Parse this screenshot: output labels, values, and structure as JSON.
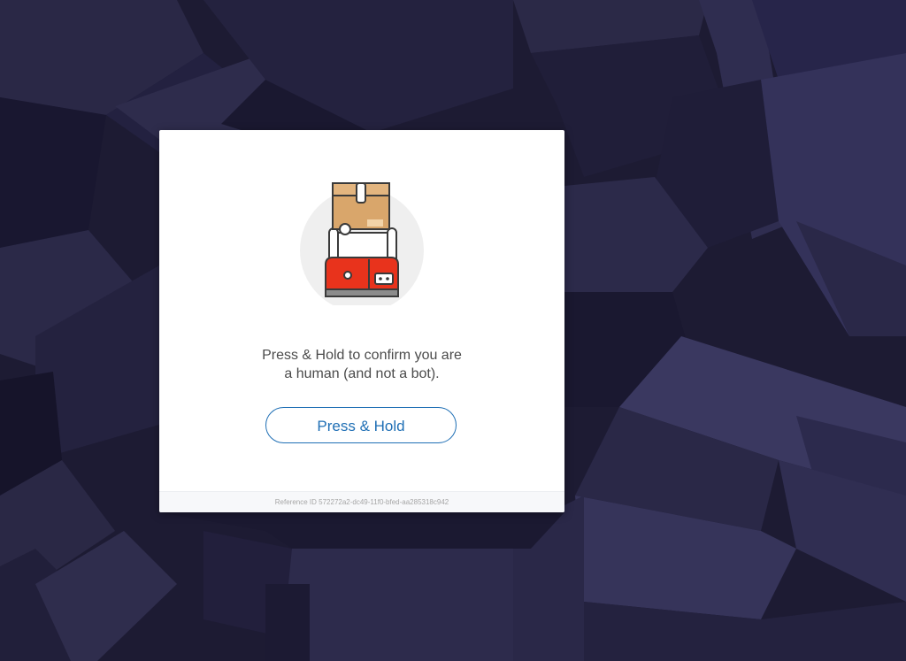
{
  "challenge": {
    "message_line1": "Press & Hold to confirm you are",
    "message_line2": "a human (and not a bot).",
    "button_label": "Press & Hold",
    "reference_label": "Reference ID",
    "reference_id": "572272a2-dc49-11f0-bfed-aa285318c942"
  },
  "colors": {
    "button_accent": "#1f6fb5",
    "background": "#1c1a33",
    "robot_red": "#e8331c",
    "box_tan": "#d9a66b"
  },
  "icons": {
    "illustration": "robot-carrying-box-icon"
  }
}
